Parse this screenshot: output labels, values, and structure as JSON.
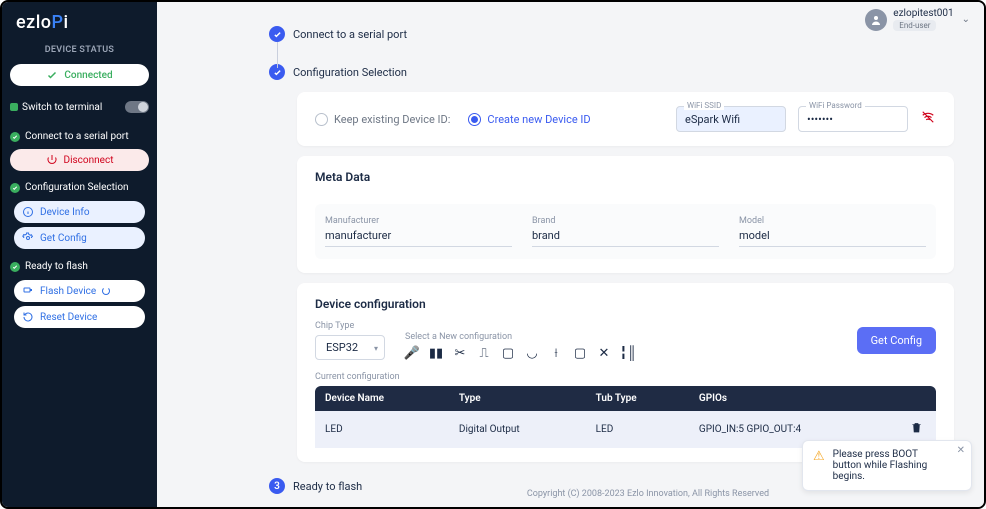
{
  "brand": "ezloPi",
  "sidebar": {
    "status_title": "DEVICE STATUS",
    "connected": "Connected",
    "switch_terminal": "Switch to terminal",
    "grp_connect": {
      "title": "Connect to a serial port",
      "disconnect": "Disconnect"
    },
    "grp_config": {
      "title": "Configuration Selection",
      "device_info": "Device Info",
      "get_config": "Get Config"
    },
    "grp_flash": {
      "title": "Ready to flash",
      "flash_device": "Flash Device",
      "reset_device": "Reset Device"
    }
  },
  "user": {
    "name": "ezlopitest001",
    "role": "End-user"
  },
  "steps": {
    "s1": "Connect to a serial port",
    "s2": "Configuration Selection",
    "s3_num": "3",
    "s3": "Ready to flash"
  },
  "device_id": {
    "keep": "Keep existing Device ID:",
    "create": "Create new Device ID"
  },
  "wifi": {
    "ssid_label": "WiFi SSID",
    "ssid_value": "eSpark Wifi",
    "pwd_label": "WiFi Password",
    "pwd_value": "•••••••"
  },
  "meta": {
    "title": "Meta Data",
    "manufacturer_label": "Manufacturer",
    "manufacturer_value": "manufacturer",
    "brand_label": "Brand",
    "brand_value": "brand",
    "model_label": "Model",
    "model_value": "model"
  },
  "cfg": {
    "title": "Device configuration",
    "chip_label": "Chip Type",
    "chip_value": "ESP32",
    "select_new": "Select a New configuration",
    "get_config_btn": "Get Config",
    "current_label": "Current configuration",
    "headers": {
      "name": "Device Name",
      "type": "Type",
      "tub": "Tub Type",
      "gpios": "GPIOs"
    },
    "row": {
      "name": "LED",
      "type": "Digital Output",
      "tub": "LED",
      "gpios": "GPIO_IN:5 GPIO_OUT:4"
    }
  },
  "footer": "Copyright (C) 2008-2023 Ezlo Innovation, All Rights Reserved",
  "toast": "Please press BOOT button while Flashing begins."
}
